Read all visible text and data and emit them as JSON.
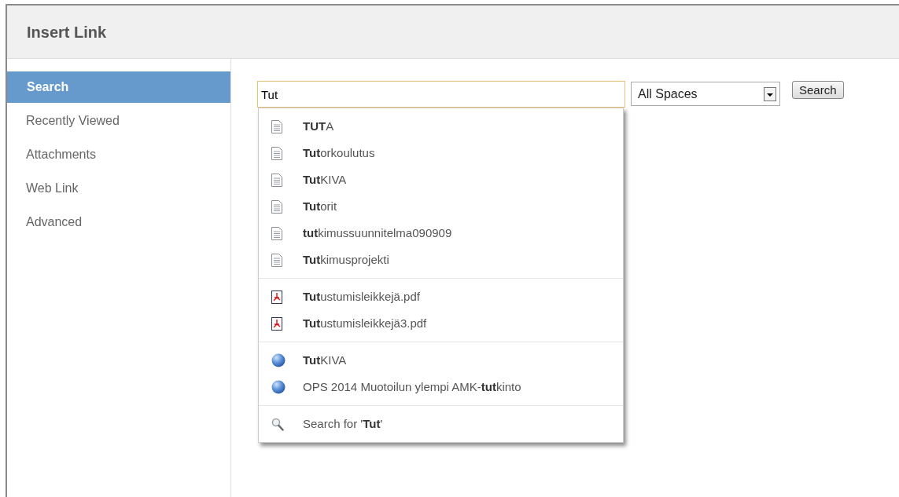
{
  "window": {
    "title": "Insert Link"
  },
  "sidebar": {
    "items": [
      {
        "label": "Search",
        "selected": true
      },
      {
        "label": "Recently Viewed",
        "selected": false
      },
      {
        "label": "Attachments",
        "selected": false
      },
      {
        "label": "Web Link",
        "selected": false
      },
      {
        "label": "Advanced",
        "selected": false
      }
    ]
  },
  "search": {
    "value": "Tut",
    "space": "All Spaces",
    "button": "Search"
  },
  "suggestions": [
    [
      {
        "kind": "page",
        "text": "**TUT**A"
      },
      {
        "kind": "page",
        "text": "**Tut**orkoulutus"
      },
      {
        "kind": "page",
        "text": "**Tut**KIVA"
      },
      {
        "kind": "page",
        "text": "**Tut**orit"
      },
      {
        "kind": "page",
        "text": "**tut**kimussuunnitelma090909"
      },
      {
        "kind": "page",
        "text": "**Tut**kimusprojekti"
      }
    ],
    [
      {
        "kind": "pdf",
        "text": "**Tut**ustumisleikkejä.pdf"
      },
      {
        "kind": "pdf",
        "text": "**Tut**ustumisleikkejä3.pdf"
      }
    ],
    [
      {
        "kind": "space",
        "text": "**Tut**KIVA"
      },
      {
        "kind": "space",
        "text": "OPS 2014 Muotoilun ylempi AMK-**tut**kinto"
      }
    ],
    [
      {
        "kind": "search",
        "text": "Search for '**Tut**'"
      }
    ]
  ]
}
